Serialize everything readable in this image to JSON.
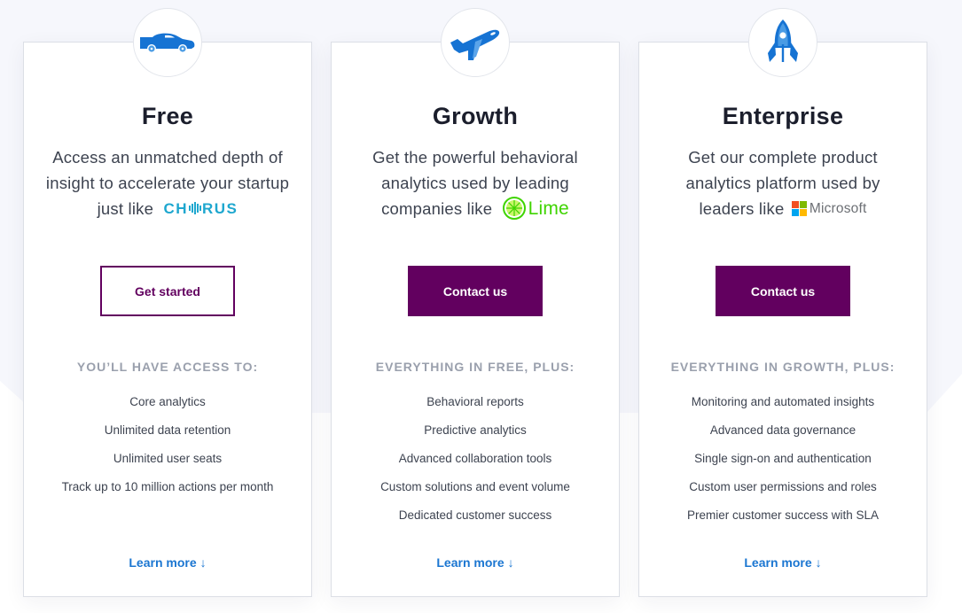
{
  "colors": {
    "brand_purple": "#62005f",
    "link_blue": "#1b76d1",
    "icon_blue": "#1673d3",
    "background_band": "#f6f7fc"
  },
  "plans": [
    {
      "icon": "car-icon",
      "title": "Free",
      "description_prefix": "Access an unmatched depth of insight to accelerate your startup just like",
      "customer_logo": {
        "name": "chorus-logo",
        "text_before": "CH",
        "text_after": "RUS"
      },
      "button": {
        "label": "Get started",
        "style": "outline"
      },
      "features_heading": "YOU’LL HAVE ACCESS TO:",
      "features": [
        "Core analytics",
        "Unlimited data retention",
        "Unlimited user seats",
        "Track up to 10 million actions per month"
      ],
      "learn_more": "Learn more",
      "learn_more_icon": "↓"
    },
    {
      "icon": "airplane-icon",
      "title": "Growth",
      "description_prefix": "Get the powerful behavioral analytics used by leading companies like",
      "customer_logo": {
        "name": "lime-logo",
        "text": "Lime"
      },
      "button": {
        "label": "Contact us",
        "style": "solid"
      },
      "features_heading": "EVERYTHING IN FREE, PLUS:",
      "features": [
        "Behavioral reports",
        "Predictive analytics",
        "Advanced collaboration tools",
        "Custom solutions and event volume",
        "Dedicated customer success"
      ],
      "learn_more": "Learn more",
      "learn_more_icon": "↓"
    },
    {
      "icon": "rocket-icon",
      "title": "Enterprise",
      "description_prefix": "Get our complete product analytics platform used by leaders like",
      "customer_logo": {
        "name": "microsoft-logo",
        "text": "Microsoft"
      },
      "button": {
        "label": "Contact us",
        "style": "solid"
      },
      "features_heading": "EVERYTHING IN GROWTH, PLUS:",
      "features": [
        "Monitoring and automated insights",
        "Advanced data governance",
        "Single sign-on and authentication",
        "Custom user permissions and roles",
        "Premier customer success with SLA"
      ],
      "learn_more": "Learn more",
      "learn_more_icon": "↓"
    }
  ]
}
